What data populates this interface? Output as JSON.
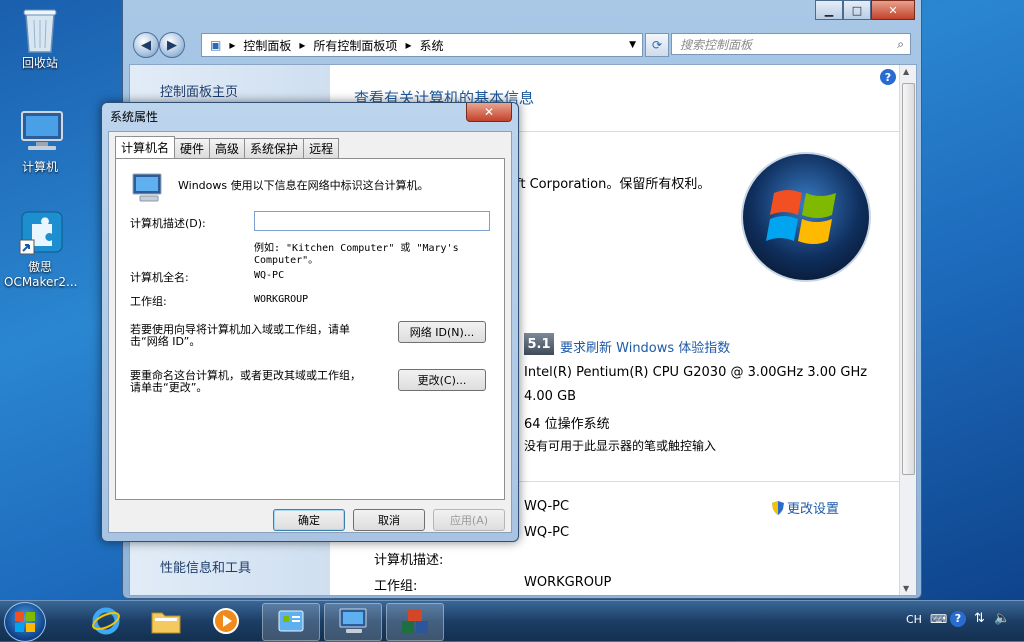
{
  "desktop": {
    "icons": [
      {
        "label": "回收站",
        "icon": "recycle-bin-icon"
      },
      {
        "label": "计算机",
        "icon": "computer-icon"
      },
      {
        "label": "傲思\nOCMaker2...",
        "label1": "傲思",
        "label2": "OCMaker2...",
        "icon": "ocmaker-shortcut-icon"
      }
    ]
  },
  "control_panel": {
    "breadcrumb": [
      "控制面板",
      "所有控制面板项",
      "系统"
    ],
    "search_placeholder": "搜索控制面板",
    "left_links": [
      "控制面板主页",
      "性能信息和工具"
    ],
    "title": "查看有关计算机的基本信息",
    "copyright": "ft Corporation。保留所有权利。",
    "rating_badge": "5.1",
    "rating_link": "要求刷新 Windows 体验指数",
    "processor": "Intel(R) Pentium(R) CPU G2030 @ 3.00GHz   3.00 GHz",
    "memory": "4.00 GB",
    "system_type": "64 位操作系统",
    "pen_touch": "没有可用于此显示器的笔或触控输入",
    "computer_name": "WQ-PC",
    "full_name": "WQ-PC",
    "desc_label": "计算机描述:",
    "workgroup_label": "工作组:",
    "workgroup": "WORKGROUP",
    "change_settings": "更改设置"
  },
  "dialog": {
    "title": "系统属性",
    "tabs": [
      "计算机名",
      "硬件",
      "高级",
      "系统保护",
      "远程"
    ],
    "intro": "Windows 使用以下信息在网络中标识这台计算机。",
    "desc_label": "计算机描述(D):",
    "desc_value": "",
    "example_line1": "例如: \"Kitchen Computer\" 或 \"Mary's",
    "example_line2": "Computer\"。",
    "fullname_label": "计算机全名:",
    "fullname_value": "WQ-PC",
    "workgroup_label": "工作组:",
    "workgroup_value": "WORKGROUP",
    "network_text1": "若要使用向导将计算机加入域或工作组，请单",
    "network_text2": "击“网络 ID”。",
    "network_button": "网络 ID(N)...",
    "rename_text1": "要重命名这台计算机，或者更改其域或工作组，",
    "rename_text2": "请单击“更改”。",
    "change_button": "更改(C)...",
    "ok_button": "确定",
    "cancel_button": "取消",
    "apply_button": "应用(A)"
  },
  "taskbar": {
    "language": "CH"
  }
}
